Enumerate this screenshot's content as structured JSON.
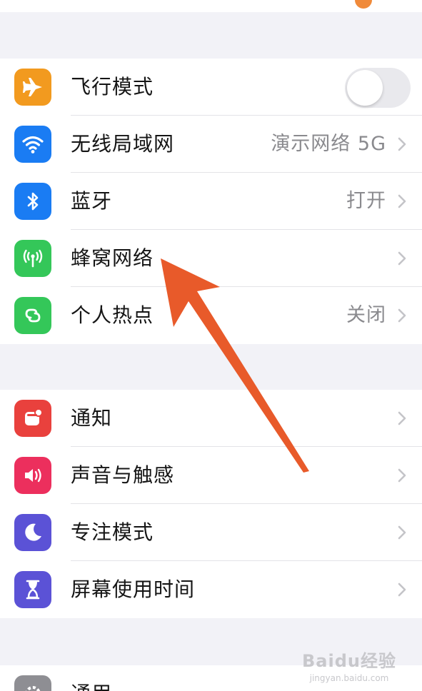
{
  "colors": {
    "orange": "#f29a1f",
    "blue": "#1a7cf3",
    "green": "#34c759",
    "red": "#e9413d",
    "pink": "#ec2f5d",
    "purple": "#5b52d6",
    "gray": "#8e8e93",
    "annotation_arrow": "#e85a2a"
  },
  "group1": [
    {
      "label": "飞行模式",
      "icon": "airplane-icon",
      "control": "toggle-off"
    },
    {
      "label": "无线局域网",
      "icon": "wifi-icon",
      "value": "演示网络 5G"
    },
    {
      "label": "蓝牙",
      "icon": "bluetooth-icon",
      "value": "打开"
    },
    {
      "label": "蜂窝网络",
      "icon": "cellular-icon",
      "value": ""
    },
    {
      "label": "个人热点",
      "icon": "hotspot-icon",
      "value": "关闭"
    }
  ],
  "group2": [
    {
      "label": "通知",
      "icon": "notification-icon"
    },
    {
      "label": "声音与触感",
      "icon": "sound-icon"
    },
    {
      "label": "专注模式",
      "icon": "moon-icon"
    },
    {
      "label": "屏幕使用时间",
      "icon": "hourglass-icon"
    }
  ],
  "group3": [
    {
      "label": "通用",
      "icon": "gear-icon"
    }
  ],
  "watermark": {
    "main": "Baidu经验",
    "sub": "jingyan.baidu.com"
  }
}
